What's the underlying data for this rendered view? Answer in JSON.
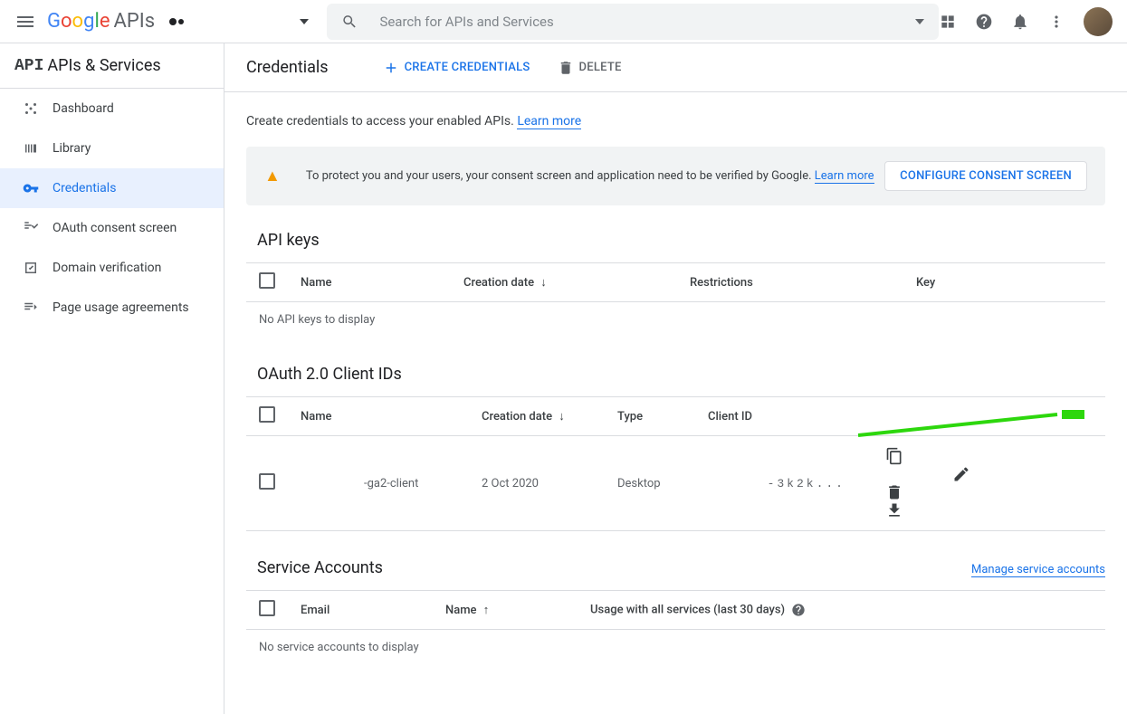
{
  "topbar": {
    "logo": {
      "apis_label": "APIs"
    },
    "search_placeholder": "Search for APIs and Services"
  },
  "sidebar": {
    "title": "APIs & Services",
    "items": [
      {
        "label": "Dashboard"
      },
      {
        "label": "Library"
      },
      {
        "label": "Credentials"
      },
      {
        "label": "OAuth consent screen"
      },
      {
        "label": "Domain verification"
      },
      {
        "label": "Page usage agreements"
      }
    ]
  },
  "header": {
    "title": "Credentials",
    "create_label": "CREATE CREDENTIALS",
    "delete_label": "DELETE"
  },
  "subtitle": {
    "text": "Create credentials to access your enabled APIs. ",
    "link": "Learn more"
  },
  "alert": {
    "text": "To protect you and your users, your consent screen and application need to be verified by Google. ",
    "link": "Learn more",
    "button_label": "CONFIGURE CONSENT SCREEN"
  },
  "sections": {
    "api_keys": {
      "title": "API keys",
      "cols": {
        "name": "Name",
        "creation": "Creation date",
        "restrictions": "Restrictions",
        "key": "Key"
      },
      "empty": "No API keys to display"
    },
    "oauth": {
      "title": "OAuth 2.0 Client IDs",
      "cols": {
        "name": "Name",
        "creation": "Creation date",
        "type": "Type",
        "client_id": "Client ID"
      },
      "rows": [
        {
          "name": "-ga2-client",
          "creation": "2 Oct 2020",
          "type": "Desktop",
          "client_id": "-3k2k..."
        }
      ]
    },
    "service_accounts": {
      "title": "Service Accounts",
      "manage_link": "Manage service accounts",
      "cols": {
        "email": "Email",
        "name": "Name",
        "usage": "Usage with all services (last 30 days)"
      },
      "empty": "No service accounts to display"
    }
  }
}
